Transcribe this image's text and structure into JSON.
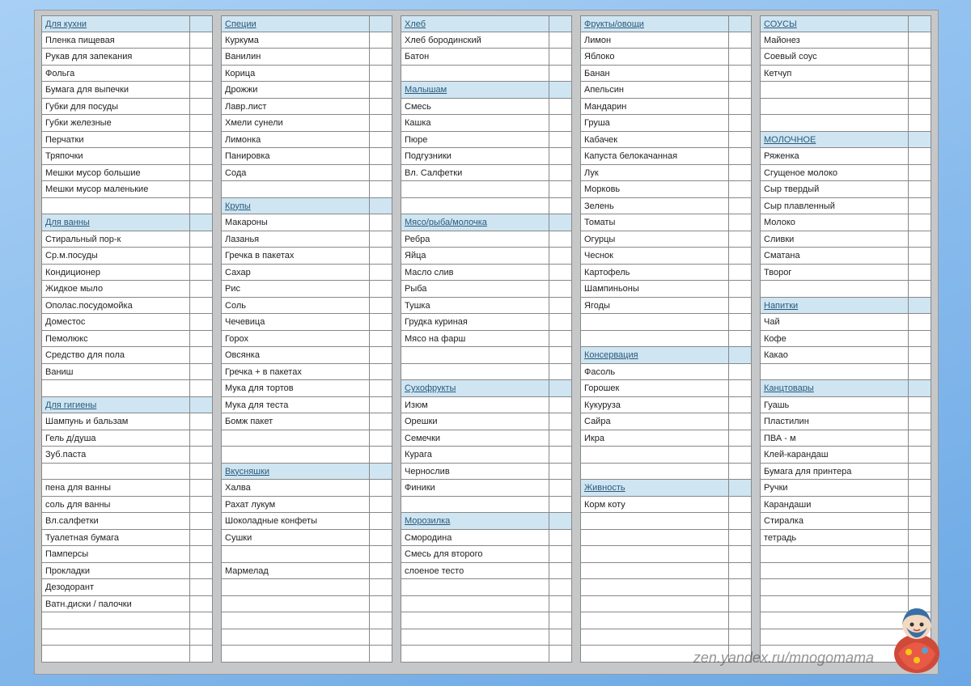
{
  "watermark": "zen.yandex.ru/mnogomama",
  "columns": [
    [
      {
        "t": "Для кухни",
        "h": 1
      },
      {
        "t": "Пленка пищевая"
      },
      {
        "t": "Рукав для запекания"
      },
      {
        "t": "Фольга"
      },
      {
        "t": "Бумага для выпечки"
      },
      {
        "t": "Губки для посуды"
      },
      {
        "t": "Губки железные"
      },
      {
        "t": "Перчатки"
      },
      {
        "t": "Тряпочки"
      },
      {
        "t": "Мешки мусор большие"
      },
      {
        "t": "Мешки мусор маленькие"
      },
      {
        "t": ""
      },
      {
        "t": "Для ванны",
        "h": 1
      },
      {
        "t": "Стиральный пор-к"
      },
      {
        "t": "Ср.м.посуды"
      },
      {
        "t": "Кондиционер"
      },
      {
        "t": "Жидкое мыло"
      },
      {
        "t": "Ополас.посудомойка"
      },
      {
        "t": "Доместос"
      },
      {
        "t": "Пемолюкс"
      },
      {
        "t": "Средство для пола"
      },
      {
        "t": "Ваниш"
      },
      {
        "t": ""
      },
      {
        "t": "Для гигиены",
        "h": 1
      },
      {
        "t": "Шампунь и бальзам"
      },
      {
        "t": "Гель д/душа"
      },
      {
        "t": "Зуб.паста"
      },
      {
        "t": ""
      },
      {
        "t": "пена для ванны"
      },
      {
        "t": "соль для ванны"
      },
      {
        "t": "Вл.салфетки"
      },
      {
        "t": "Туалетная бумага"
      },
      {
        "t": "Памперсы"
      },
      {
        "t": "Прокладки"
      },
      {
        "t": "Дезодорант"
      },
      {
        "t": "Ватн.диски / палочки"
      },
      {
        "t": ""
      },
      {
        "t": ""
      },
      {
        "t": ""
      }
    ],
    [
      {
        "t": "Специи",
        "h": 1
      },
      {
        "t": "Куркума"
      },
      {
        "t": "Ванилин"
      },
      {
        "t": "Корица"
      },
      {
        "t": "Дрожжи"
      },
      {
        "t": "Лавр.лист"
      },
      {
        "t": "Хмели сунели"
      },
      {
        "t": "Лимонка"
      },
      {
        "t": "Панировка"
      },
      {
        "t": "Сода"
      },
      {
        "t": ""
      },
      {
        "t": "Крупы",
        "h": 1
      },
      {
        "t": "Макароны"
      },
      {
        "t": "Лазанья"
      },
      {
        "t": "Гречка в пакетах"
      },
      {
        "t": "Сахар"
      },
      {
        "t": "Рис"
      },
      {
        "t": "Соль"
      },
      {
        "t": "Чечевица"
      },
      {
        "t": "Горох"
      },
      {
        "t": "Овсянка"
      },
      {
        "t": "Гречка + в пакетах"
      },
      {
        "t": "Мука для тортов"
      },
      {
        "t": "Мука для теста"
      },
      {
        "t": "Бомж пакет"
      },
      {
        "t": ""
      },
      {
        "t": ""
      },
      {
        "t": "Вкусняшки",
        "h": 1
      },
      {
        "t": "Халва"
      },
      {
        "t": "Рахат лукум"
      },
      {
        "t": "Шоколадные конфеты"
      },
      {
        "t": "Сушки"
      },
      {
        "t": ""
      },
      {
        "t": "Мармелад"
      },
      {
        "t": ""
      },
      {
        "t": ""
      },
      {
        "t": ""
      },
      {
        "t": ""
      },
      {
        "t": ""
      }
    ],
    [
      {
        "t": "Хлеб",
        "h": 1
      },
      {
        "t": "Хлеб бородинский"
      },
      {
        "t": "Батон"
      },
      {
        "t": ""
      },
      {
        "t": "Малышам",
        "h": 1
      },
      {
        "t": "Смесь"
      },
      {
        "t": "Кашка"
      },
      {
        "t": "Пюре"
      },
      {
        "t": "Подгузники"
      },
      {
        "t": "Вл. Салфетки"
      },
      {
        "t": ""
      },
      {
        "t": ""
      },
      {
        "t": "Мясо/рыба/молочка",
        "h": 1
      },
      {
        "t": "Ребра"
      },
      {
        "t": "Яйца"
      },
      {
        "t": "Масло слив"
      },
      {
        "t": "Рыба"
      },
      {
        "t": "Тушка"
      },
      {
        "t": "Грудка куриная"
      },
      {
        "t": "Мясо на фарш"
      },
      {
        "t": ""
      },
      {
        "t": ""
      },
      {
        "t": "Сухофрукты",
        "h": 1
      },
      {
        "t": "Изюм"
      },
      {
        "t": "Орешки"
      },
      {
        "t": "Семечки"
      },
      {
        "t": "Курага"
      },
      {
        "t": "Чернослив"
      },
      {
        "t": "Финики"
      },
      {
        "t": ""
      },
      {
        "t": "Морозилка",
        "h": 1
      },
      {
        "t": "Смородина"
      },
      {
        "t": "Смесь для второго"
      },
      {
        "t": "слоеное тесто"
      },
      {
        "t": ""
      },
      {
        "t": ""
      },
      {
        "t": ""
      },
      {
        "t": ""
      },
      {
        "t": ""
      }
    ],
    [
      {
        "t": "Фрукты/овощи",
        "h": 1
      },
      {
        "t": "Лимон"
      },
      {
        "t": "Яблоко"
      },
      {
        "t": "Банан"
      },
      {
        "t": "Апельсин"
      },
      {
        "t": "Мандарин"
      },
      {
        "t": "Груша"
      },
      {
        "t": "Кабачек"
      },
      {
        "t": "Капуста белокачанная"
      },
      {
        "t": "Лук"
      },
      {
        "t": "Морковь"
      },
      {
        "t": "Зелень"
      },
      {
        "t": "Томаты"
      },
      {
        "t": "Огурцы"
      },
      {
        "t": "Чеснок"
      },
      {
        "t": "Картофель"
      },
      {
        "t": "Шампиньоны"
      },
      {
        "t": "Ягоды"
      },
      {
        "t": ""
      },
      {
        "t": ""
      },
      {
        "t": "Консервация",
        "h": 1
      },
      {
        "t": "Фасоль"
      },
      {
        "t": "Горошек"
      },
      {
        "t": "Кукуруза"
      },
      {
        "t": "Сайра"
      },
      {
        "t": "Икра"
      },
      {
        "t": ""
      },
      {
        "t": ""
      },
      {
        "t": "Живность",
        "h": 1
      },
      {
        "t": "Корм коту"
      },
      {
        "t": ""
      },
      {
        "t": ""
      },
      {
        "t": ""
      },
      {
        "t": ""
      },
      {
        "t": ""
      },
      {
        "t": ""
      },
      {
        "t": ""
      },
      {
        "t": ""
      },
      {
        "t": ""
      }
    ],
    [
      {
        "t": "СОУСЫ",
        "h": 1
      },
      {
        "t": "Майонез"
      },
      {
        "t": "Соевый соус"
      },
      {
        "t": "Кетчуп"
      },
      {
        "t": ""
      },
      {
        "t": ""
      },
      {
        "t": ""
      },
      {
        "t": "МОЛОЧНОЕ",
        "h": 1
      },
      {
        "t": "Ряженка"
      },
      {
        "t": "Сгущеное молоко"
      },
      {
        "t": "Сыр твердый"
      },
      {
        "t": "Сыр плавленный"
      },
      {
        "t": "Молоко"
      },
      {
        "t": "Сливки"
      },
      {
        "t": "Сматана"
      },
      {
        "t": "Творог"
      },
      {
        "t": ""
      },
      {
        "t": "Напитки",
        "h": 1
      },
      {
        "t": "Чай"
      },
      {
        "t": "Кофе"
      },
      {
        "t": "Какао"
      },
      {
        "t": ""
      },
      {
        "t": "Канцтовары",
        "h": 1
      },
      {
        "t": "Гуашь"
      },
      {
        "t": "Пластилин"
      },
      {
        "t": "ПВА - м"
      },
      {
        "t": "Клей-карандаш"
      },
      {
        "t": "Бумага для принтера"
      },
      {
        "t": "Ручки"
      },
      {
        "t": "Карандаши"
      },
      {
        "t": "Стиралка"
      },
      {
        "t": "тетрадь"
      },
      {
        "t": ""
      },
      {
        "t": ""
      },
      {
        "t": ""
      },
      {
        "t": ""
      },
      {
        "t": ""
      },
      {
        "t": ""
      },
      {
        "t": ""
      }
    ]
  ]
}
